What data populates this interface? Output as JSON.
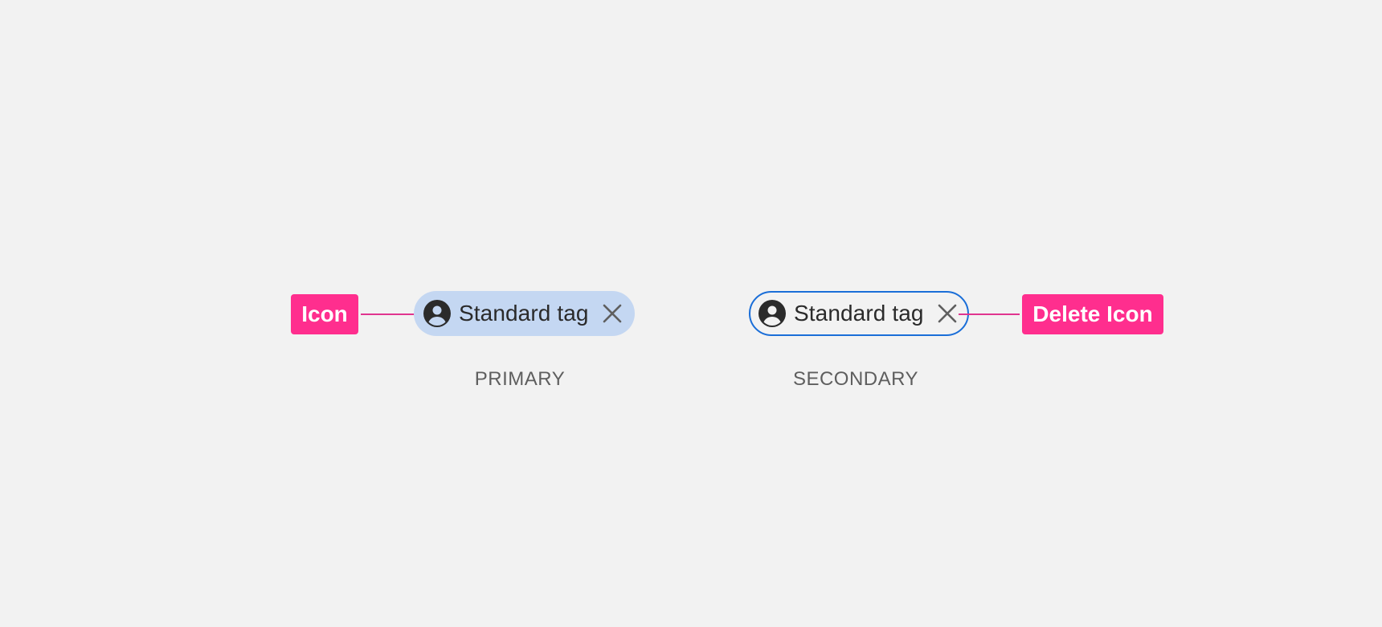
{
  "callouts": {
    "icon_label": "Icon",
    "delete_icon_label": "Delete Icon"
  },
  "tags": {
    "primary": {
      "label": "Standard tag",
      "icon": "user-circle-icon",
      "delete_icon": "close-icon",
      "caption": "PRIMARY"
    },
    "secondary": {
      "label": "Standard tag",
      "icon": "user-circle-icon",
      "delete_icon": "close-icon",
      "caption": "SECONDARY"
    }
  },
  "colors": {
    "background": "#f2f2f2",
    "callout": "#ff2e8e",
    "primary_fill": "#c4d7f2",
    "secondary_border": "#1a6ed8",
    "text": "#2a2a2a",
    "caption": "#5e5e5e"
  }
}
